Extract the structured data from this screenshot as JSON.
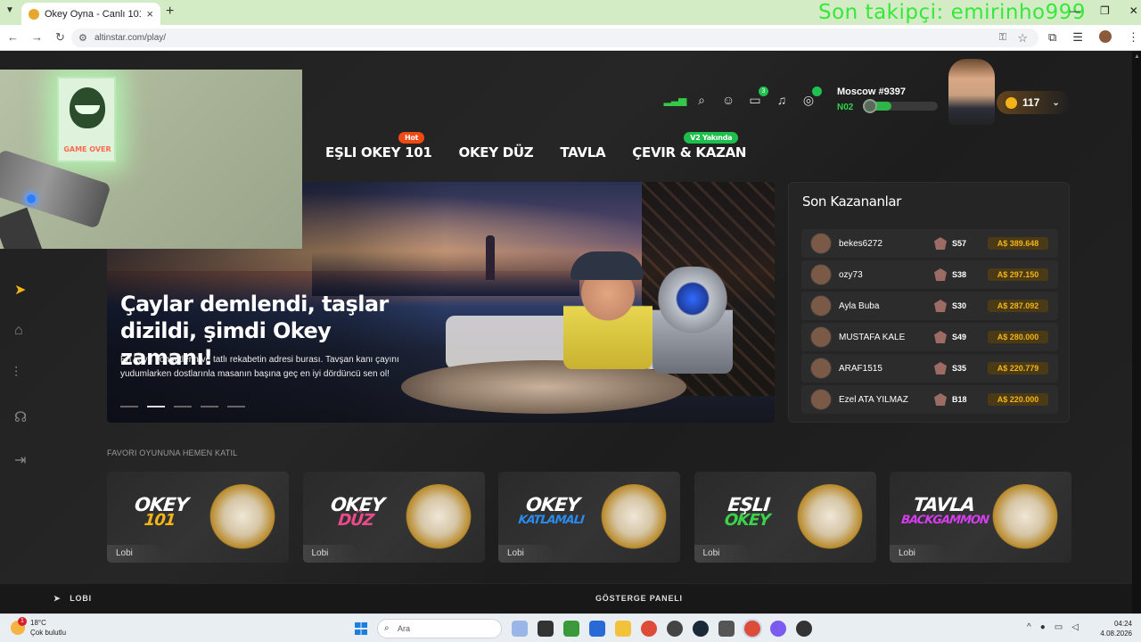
{
  "browser": {
    "tab_title": "Okey Oyna - Canlı 101 Okey ve",
    "url": "altinstar.com/play/",
    "new_tab": "+",
    "close": "×"
  },
  "stream_overlay": "Son takipçi: emirinho999",
  "webcam": {
    "poster_text": "GAME OVER"
  },
  "header": {
    "profile_name": "Moscow #9397",
    "level": "N02",
    "xp_progress": 0.38,
    "coins": "117",
    "chat_badge": "3"
  },
  "menu": [
    {
      "label": "EŞLI OKEY 101",
      "badge": "Hot"
    },
    {
      "label": "OKEY DÜZ"
    },
    {
      "label": "TAVLA"
    },
    {
      "label": "ÇEVIR & KAZAN",
      "badge": "V2 Yakında"
    }
  ],
  "banner": {
    "title": "Çaylar demlendi, taşlar dizildi, şimdi Okey zamanı!",
    "text": "En koyu sohbetlerin ve tatlı rekabetin adresi burası. Tavşan kanı çayını yudumlarken dostlarınla masanın başına geç en iyi dördüncü sen ol!",
    "active_slide": 1,
    "slides": 5
  },
  "winners": {
    "title": "Son Kazananlar",
    "rows": [
      {
        "name": "bekes6272",
        "level": "S57",
        "prize": "A$ 389.648"
      },
      {
        "name": "ozy73",
        "level": "S38",
        "prize": "A$ 297.150"
      },
      {
        "name": "Ayla Buba",
        "level": "S30",
        "prize": "A$ 287.092"
      },
      {
        "name": "MUSTAFA KALE",
        "level": "S49",
        "prize": "A$ 280.000"
      },
      {
        "name": "ARAF1515",
        "level": "S35",
        "prize": "A$ 220.779"
      },
      {
        "name": "Ezel ATA YILMAZ",
        "level": "B18",
        "prize": "A$ 220.000"
      }
    ]
  },
  "favorites": {
    "label": "FAVORI OYUNUNA HEMEN KATIL",
    "cards": [
      {
        "line1": "OKEY",
        "line2": "101",
        "c1": "#ffffff",
        "c2": "#f2b418",
        "lobi": "Lobi"
      },
      {
        "line1": "OKEY",
        "line2": "DÜZ",
        "c1": "#ffffff",
        "c2": "#e84a8a",
        "lobi": "Lobi"
      },
      {
        "line1": "OKEY",
        "line2": "KATLAMALI",
        "c1": "#ffffff",
        "c2": "#2a8cf0",
        "lobi": "Lobi"
      },
      {
        "line1": "EŞLI",
        "line2": "OKEY",
        "c1": "#ffffff",
        "c2": "#3cd14a",
        "lobi": "Lobi"
      },
      {
        "line1": "TAVLA",
        "line2": "BACKGAMMON",
        "c1": "#ffffff",
        "c2": "#d63cf0",
        "lobi": "Lobi"
      }
    ]
  },
  "bottom_bar": {
    "lobi": "LOBI",
    "panel": "GÖSTERGE PANELI"
  },
  "taskbar": {
    "temp": "18°C",
    "weather": "Çok bulutlu",
    "notif": "1",
    "search": "Ara",
    "time": "04:24",
    "date": "4.08.2026"
  },
  "colors": {
    "accent": "#2fd34c",
    "gold": "#f2b418",
    "hot": "#f04a14"
  }
}
